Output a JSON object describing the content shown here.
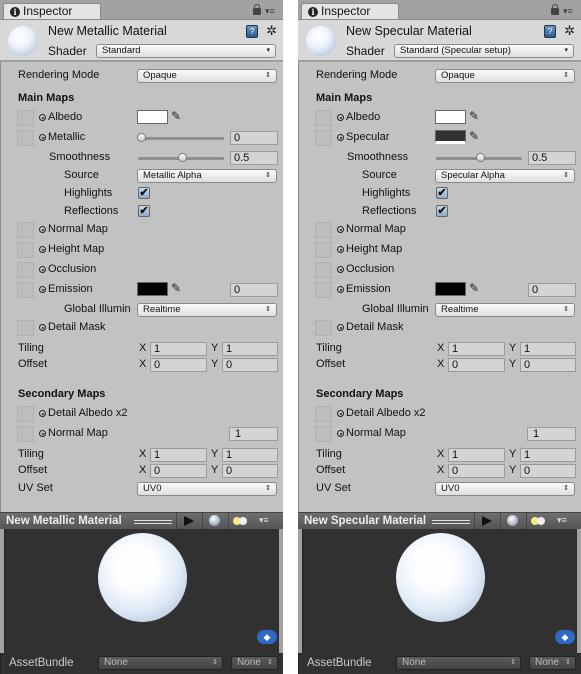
{
  "panels": [
    {
      "tab": "Inspector",
      "material_name": "New Metallic Material",
      "shader_label": "Shader",
      "shader": "Standard",
      "rendering_mode_label": "Rendering Mode",
      "rendering_mode": "Opaque",
      "main_maps_label": "Main Maps",
      "albedo_label": "Albedo",
      "albedo_color": "#ffffff",
      "second_label": "Metallic",
      "second_type": "slider",
      "metallic_value": "0",
      "metallic_fraction": 0,
      "specular_color": "",
      "smoothness_label": "Smoothness",
      "smoothness_value": "0.5",
      "smoothness_fraction": 0.5,
      "source_label": "Source",
      "source": "Metallic Alpha",
      "highlights_label": "Highlights",
      "highlights": true,
      "reflections_label": "Reflections",
      "reflections": true,
      "normal_map_label": "Normal Map",
      "height_map_label": "Height Map",
      "occlusion_label": "Occlusion",
      "emission_label": "Emission",
      "emission_color": "#000000",
      "emission_value": "0",
      "gi_label": "Global Illumin",
      "gi": "Realtime",
      "detail_mask_label": "Detail Mask",
      "tiling_label": "Tiling",
      "offset_label": "Offset",
      "x_label": "X",
      "y_label": "Y",
      "main_tiling": {
        "x": "1",
        "y": "1"
      },
      "main_offset": {
        "x": "0",
        "y": "0"
      },
      "secondary_maps_label": "Secondary Maps",
      "detail_albedo_label": "Detail Albedo x2",
      "secondary_normal_label": "Normal Map",
      "secondary_normal_value": "1",
      "secondary_tiling": {
        "x": "1",
        "y": "1"
      },
      "secondary_offset": {
        "x": "0",
        "y": "0"
      },
      "uv_set_label": "UV Set",
      "uv_set": "UV0",
      "preview_title": "New Metallic Material",
      "asset_bundle_label": "AssetBundle",
      "asset_bundle": "None",
      "asset_variant": "None"
    },
    {
      "tab": "Inspector",
      "material_name": "New Specular Material",
      "shader_label": "Shader",
      "shader": "Standard (Specular setup)",
      "rendering_mode_label": "Rendering Mode",
      "rendering_mode": "Opaque",
      "main_maps_label": "Main Maps",
      "albedo_label": "Albedo",
      "albedo_color": "#ffffff",
      "second_label": "Specular",
      "second_type": "color",
      "metallic_value": "",
      "metallic_fraction": 0,
      "specular_color": "#333333",
      "smoothness_label": "Smoothness",
      "smoothness_value": "0.5",
      "smoothness_fraction": 0.5,
      "source_label": "Source",
      "source": "Specular Alpha",
      "highlights_label": "Highlights",
      "highlights": true,
      "reflections_label": "Reflections",
      "reflections": true,
      "normal_map_label": "Normal Map",
      "height_map_label": "Height Map",
      "occlusion_label": "Occlusion",
      "emission_label": "Emission",
      "emission_color": "#000000",
      "emission_value": "0",
      "gi_label": "Global Illumin",
      "gi": "Realtime",
      "detail_mask_label": "Detail Mask",
      "tiling_label": "Tiling",
      "offset_label": "Offset",
      "x_label": "X",
      "y_label": "Y",
      "main_tiling": {
        "x": "1",
        "y": "1"
      },
      "main_offset": {
        "x": "0",
        "y": "0"
      },
      "secondary_maps_label": "Secondary Maps",
      "detail_albedo_label": "Detail Albedo x2",
      "secondary_normal_label": "Normal Map",
      "secondary_normal_value": "1",
      "secondary_tiling": {
        "x": "1",
        "y": "1"
      },
      "secondary_offset": {
        "x": "0",
        "y": "0"
      },
      "uv_set_label": "UV Set",
      "uv_set": "UV0",
      "preview_title": "New Specular Material",
      "asset_bundle_label": "AssetBundle",
      "asset_bundle": "None",
      "asset_variant": "None"
    }
  ],
  "icons": {
    "tab_info": "i",
    "checkmark": "✔",
    "select_arrow": "▾",
    "updown_arrow": "⇕",
    "picker": "✎",
    "gear": "✲",
    "help": "?",
    "menu": "▾≡",
    "tag": "◆"
  }
}
